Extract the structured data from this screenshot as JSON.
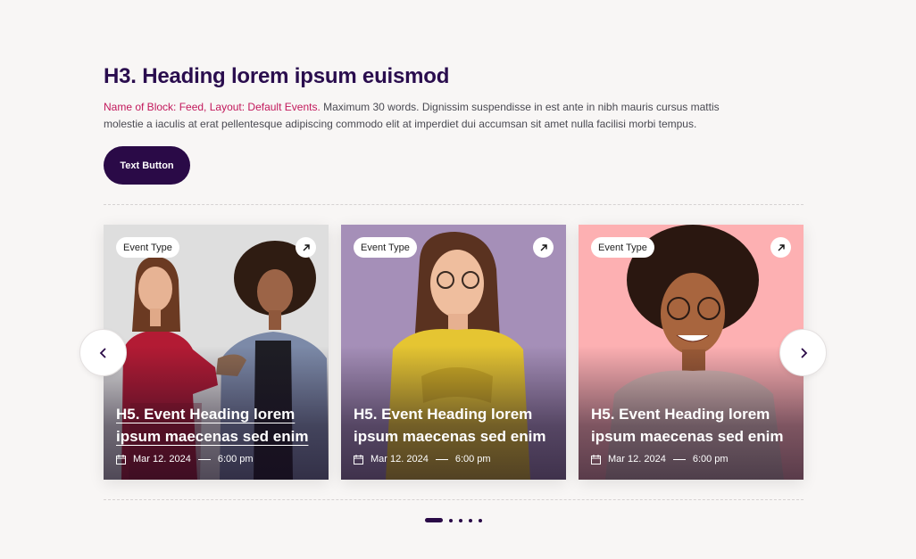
{
  "header": {
    "title": "H3. Heading lorem ipsum euismod",
    "description_highlight": "Name of Block: Feed, Layout: Default Events.",
    "description_rest": " Maximum 30 words. Dignissim suspendisse in est ante in nibh mauris cursus mattis molestie a iaculis at erat pellentesque adipiscing commodo elit at imperdiet dui accumsan sit amet nulla facilisi morbi tempus.",
    "button_label": "Text Button"
  },
  "cards": [
    {
      "tag": "Event Type",
      "title": "H5. Event Heading lorem ipsum maecenas sed enim",
      "date": "Mar 12. 2024",
      "time": "6:00 pm",
      "bg": "#dedede",
      "underlined": true
    },
    {
      "tag": "Event Type",
      "title": "H5. Event Heading lorem ipsum maecenas sed enim",
      "date": "Mar 12. 2024",
      "time": "6:00 pm",
      "bg": "#a58fb8",
      "underlined": false
    },
    {
      "tag": "Event Type",
      "title": "H5. Event Heading lorem ipsum maecenas sed enim",
      "date": "Mar 12. 2024",
      "time": "6:00 pm",
      "bg": "#fdb0b2",
      "underlined": false
    }
  ],
  "carousel": {
    "prev_icon": "chevron-left-icon",
    "next_icon": "chevron-right-icon",
    "page_count": 5,
    "active_page": 1
  },
  "colors": {
    "accent": "#2a0a47",
    "highlight": "#c2185b",
    "background": "#f8f6f5"
  }
}
